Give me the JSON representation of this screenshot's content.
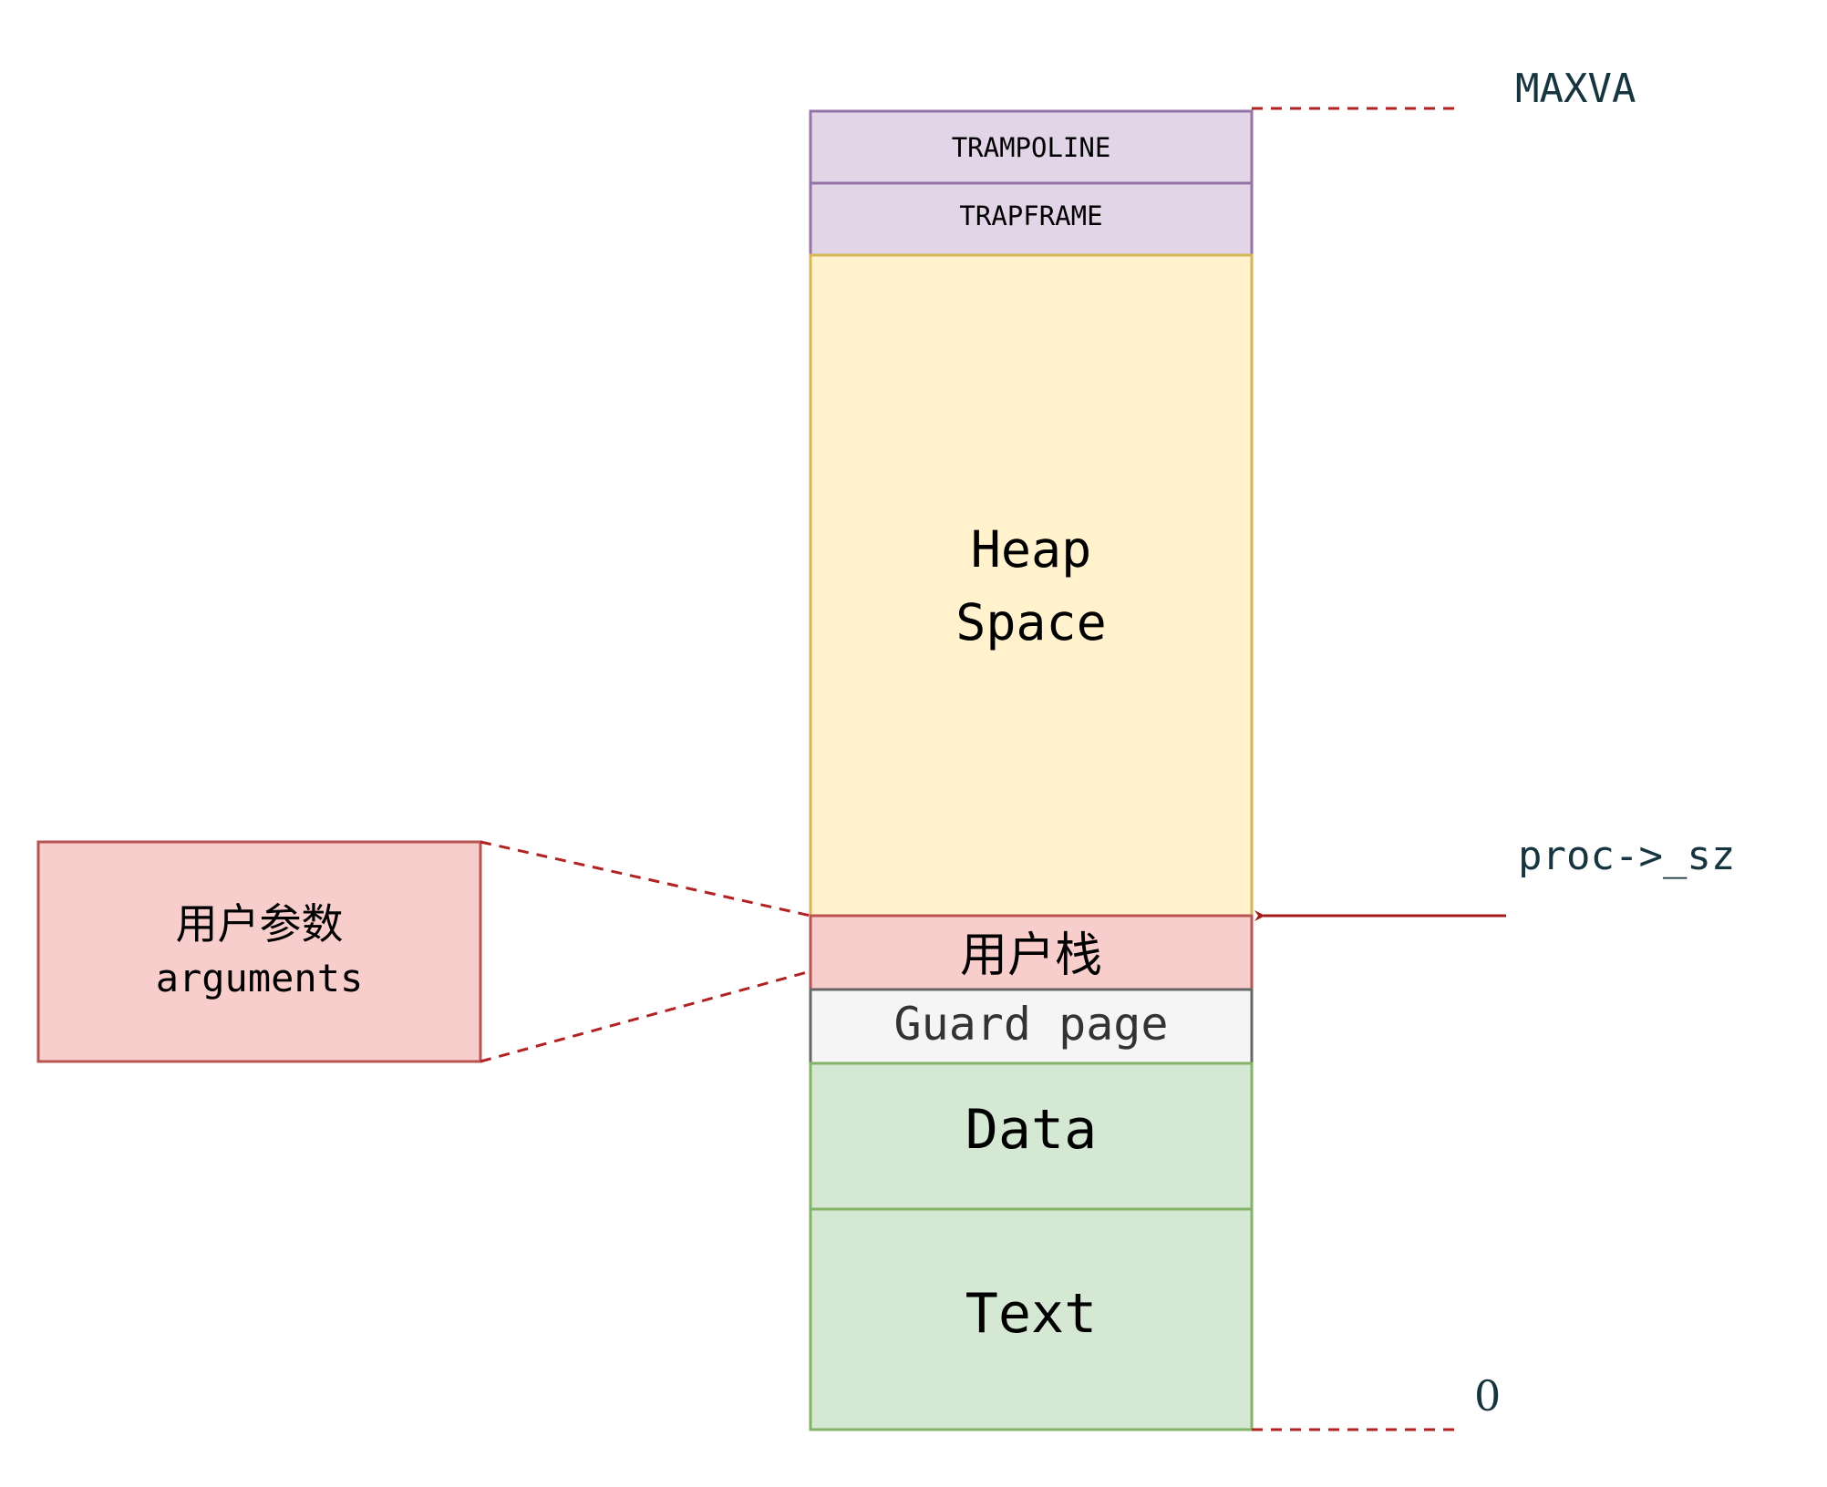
{
  "regions": {
    "trampoline": "TRAMPOLINE",
    "trapframe": "TRAPFRAME",
    "heap": "Heap\nSpace",
    "user_stack": "用户栈",
    "guard_page": "Guard page",
    "data": "Data",
    "text": "Text"
  },
  "callout": {
    "line1": "用户参数",
    "line2": "arguments"
  },
  "markers": {
    "maxva": "MAXVA",
    "proc_sz": "proc->_sz",
    "zero": "0"
  },
  "colors": {
    "purple_fill": "#e1d5e7",
    "purple_stroke": "#9673a6",
    "yellow_fill": "#fff2cc",
    "yellow_stroke": "#d6b656",
    "red_fill": "#f8cecc",
    "red_stroke": "#b85450",
    "grey_fill": "#f5f5f5",
    "grey_stroke": "#666666",
    "green_fill": "#d5e8d4",
    "green_stroke": "#82b366",
    "dashed_line": "#b22222",
    "arrow": "#a51c1c"
  }
}
